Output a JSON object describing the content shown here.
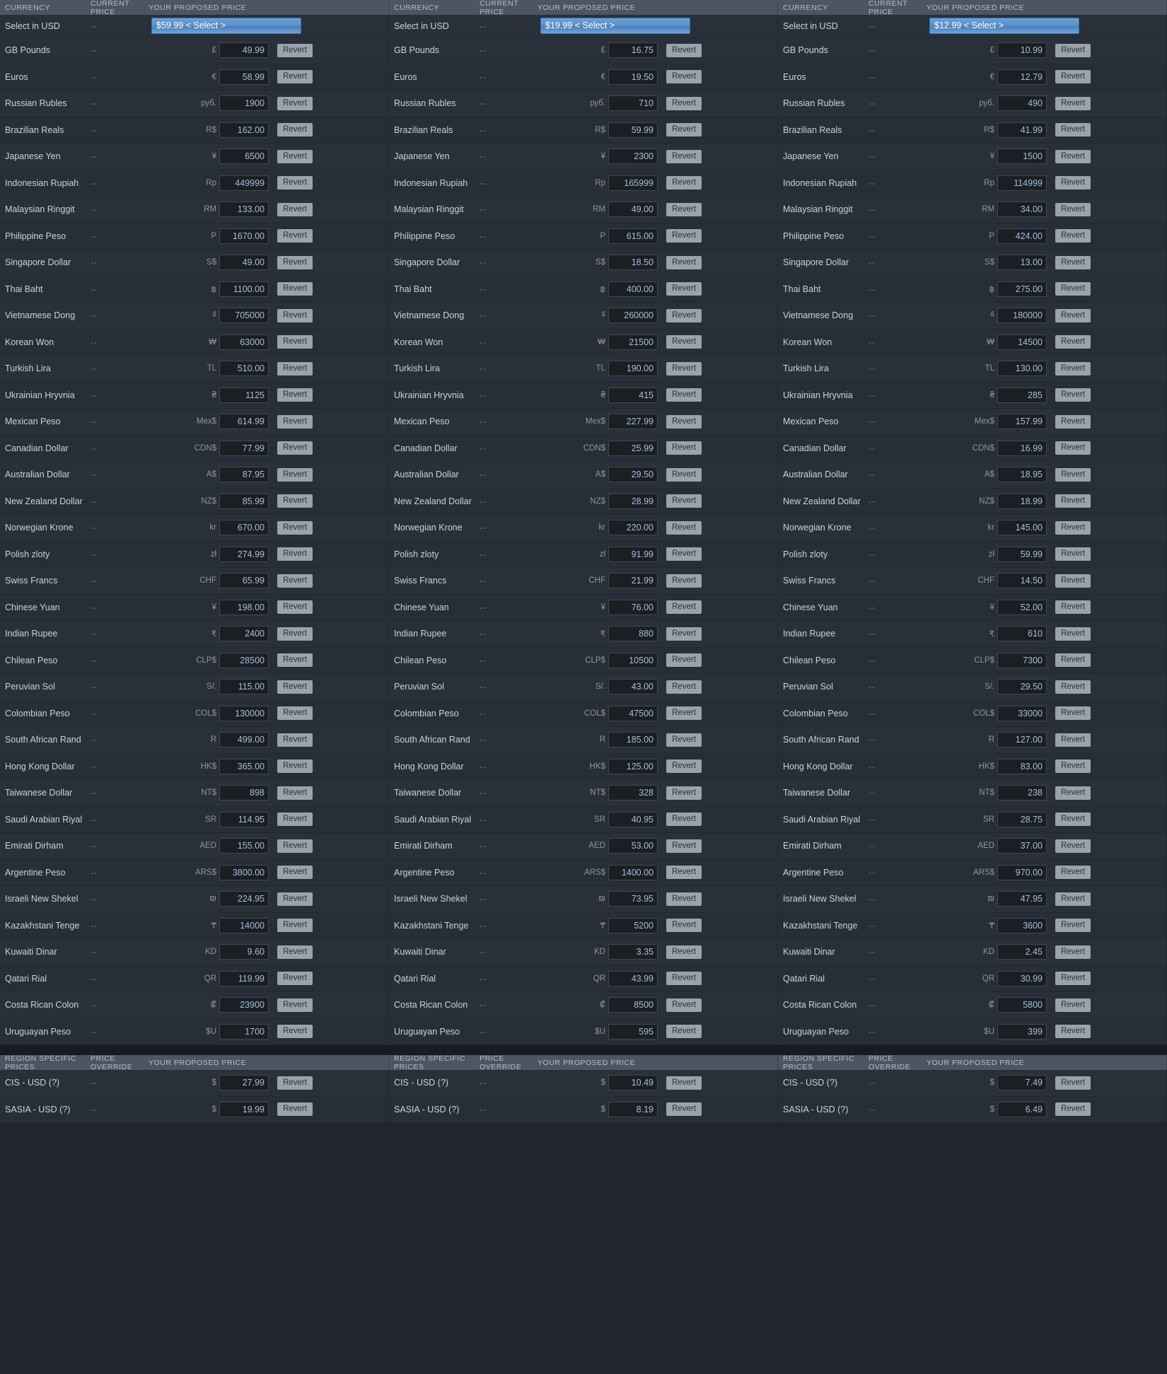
{
  "columns_header": {
    "currency": "CURRENCY",
    "current_price": "CURRENT PRICE",
    "proposed_price": "YOUR PROPOSED PRICE"
  },
  "region_header": {
    "region": "REGION SPECIFIC PRICES",
    "override": "PRICE OVERRIDE",
    "proposed_price": "YOUR PROPOSED PRICE"
  },
  "labels": {
    "revert": "Revert",
    "no_price": "--",
    "select_in_usd": "Select in USD"
  },
  "colors": {
    "accent": "#5d93cc",
    "header_bg": "#4d5562",
    "row_bg": "#2a303a",
    "input_text": "#9fc0e0",
    "revert_bg": "#9aa2ab"
  },
  "currencies": [
    {
      "name": "GB Pounds",
      "symbol": "£"
    },
    {
      "name": "Euros",
      "symbol": "€"
    },
    {
      "name": "Russian Rubles",
      "symbol": "руб."
    },
    {
      "name": "Brazilian Reals",
      "symbol": "R$"
    },
    {
      "name": "Japanese Yen",
      "symbol": "¥"
    },
    {
      "name": "Indonesian Rupiah",
      "symbol": "Rp"
    },
    {
      "name": "Malaysian Ringgit",
      "symbol": "RM"
    },
    {
      "name": "Philippine Peso",
      "symbol": "P"
    },
    {
      "name": "Singapore Dollar",
      "symbol": "S$"
    },
    {
      "name": "Thai Baht",
      "symbol": "฿"
    },
    {
      "name": "Vietnamese Dong",
      "symbol": "₫"
    },
    {
      "name": "Korean Won",
      "symbol": "₩"
    },
    {
      "name": "Turkish Lira",
      "symbol": "TL"
    },
    {
      "name": "Ukrainian Hryvnia",
      "symbol": "₴"
    },
    {
      "name": "Mexican Peso",
      "symbol": "Mex$"
    },
    {
      "name": "Canadian Dollar",
      "symbol": "CDN$"
    },
    {
      "name": "Australian Dollar",
      "symbol": "A$"
    },
    {
      "name": "New Zealand Dollar",
      "symbol": "NZ$"
    },
    {
      "name": "Norwegian Krone",
      "symbol": "kr"
    },
    {
      "name": "Polish zloty",
      "symbol": "zł"
    },
    {
      "name": "Swiss Francs",
      "symbol": "CHF"
    },
    {
      "name": "Chinese Yuan",
      "symbol": "¥"
    },
    {
      "name": "Indian Rupee",
      "symbol": "₹"
    },
    {
      "name": "Chilean Peso",
      "symbol": "CLP$"
    },
    {
      "name": "Peruvian Sol",
      "symbol": "S/."
    },
    {
      "name": "Colombian Peso",
      "symbol": "COL$"
    },
    {
      "name": "South African Rand",
      "symbol": "R"
    },
    {
      "name": "Hong Kong Dollar",
      "symbol": "HK$"
    },
    {
      "name": "Taiwanese Dollar",
      "symbol": "NT$"
    },
    {
      "name": "Saudi Arabian Riyal",
      "symbol": "SR"
    },
    {
      "name": "Emirati Dirham",
      "symbol": "AED"
    },
    {
      "name": "Argentine Peso",
      "symbol": "ARS$"
    },
    {
      "name": "Israeli New Shekel",
      "symbol": "₪"
    },
    {
      "name": "Kazakhstani Tenge",
      "symbol": "₸"
    },
    {
      "name": "Kuwaiti Dinar",
      "symbol": "KD"
    },
    {
      "name": "Qatari Rial",
      "symbol": "QR"
    },
    {
      "name": "Costa Rican Colon",
      "symbol": "₡"
    },
    {
      "name": "Uruguayan Peso",
      "symbol": "$U"
    }
  ],
  "regions": [
    {
      "name": "CIS - USD (?)",
      "symbol": "$"
    },
    {
      "name": "SASIA - USD (?)",
      "symbol": "$"
    }
  ],
  "panels": [
    {
      "usd_tier": "$59.99 < Select >",
      "prices": [
        "49.99",
        "58.99",
        "1900",
        "162.00",
        "6500",
        "449999",
        "133.00",
        "1670.00",
        "49.00",
        "1100.00",
        "705000",
        "63000",
        "510.00",
        "1125",
        "614.99",
        "77.99",
        "87.95",
        "85.99",
        "670.00",
        "274.99",
        "65.99",
        "198.00",
        "2400",
        "28500",
        "115.00",
        "130000",
        "499.00",
        "365.00",
        "898",
        "114.95",
        "155.00",
        "3800.00",
        "224.95",
        "14000",
        "9.60",
        "119.99",
        "23900",
        "1700"
      ],
      "region_prices": [
        "27.99",
        "19.99"
      ]
    },
    {
      "usd_tier": "$19.99 < Select >",
      "prices": [
        "16.75",
        "19.50",
        "710",
        "59.99",
        "2300",
        "165999",
        "49.00",
        "615.00",
        "18.50",
        "400.00",
        "260000",
        "21500",
        "190.00",
        "415",
        "227.99",
        "25.99",
        "29.50",
        "28.99",
        "220.00",
        "91.99",
        "21.99",
        "76.00",
        "880",
        "10500",
        "43.00",
        "47500",
        "185.00",
        "125.00",
        "328",
        "40.95",
        "53.00",
        "1400.00",
        "73.95",
        "5200",
        "3.35",
        "43.99",
        "8500",
        "595"
      ],
      "region_prices": [
        "10.49",
        "8.19"
      ]
    },
    {
      "usd_tier": "$12.99 < Select >",
      "prices": [
        "10.99",
        "12.79",
        "490",
        "41.99",
        "1500",
        "114999",
        "34.00",
        "424.00",
        "13.00",
        "275.00",
        "180000",
        "14500",
        "130.00",
        "285",
        "157.99",
        "16.99",
        "18.95",
        "18.99",
        "145.00",
        "59.99",
        "14.50",
        "52.00",
        "610",
        "7300",
        "29.50",
        "33000",
        "127.00",
        "83.00",
        "238",
        "28.75",
        "37.00",
        "970.00",
        "47.95",
        "3600",
        "2.45",
        "30.99",
        "5800",
        "399"
      ],
      "region_prices": [
        "7.49",
        "6.49"
      ]
    }
  ]
}
